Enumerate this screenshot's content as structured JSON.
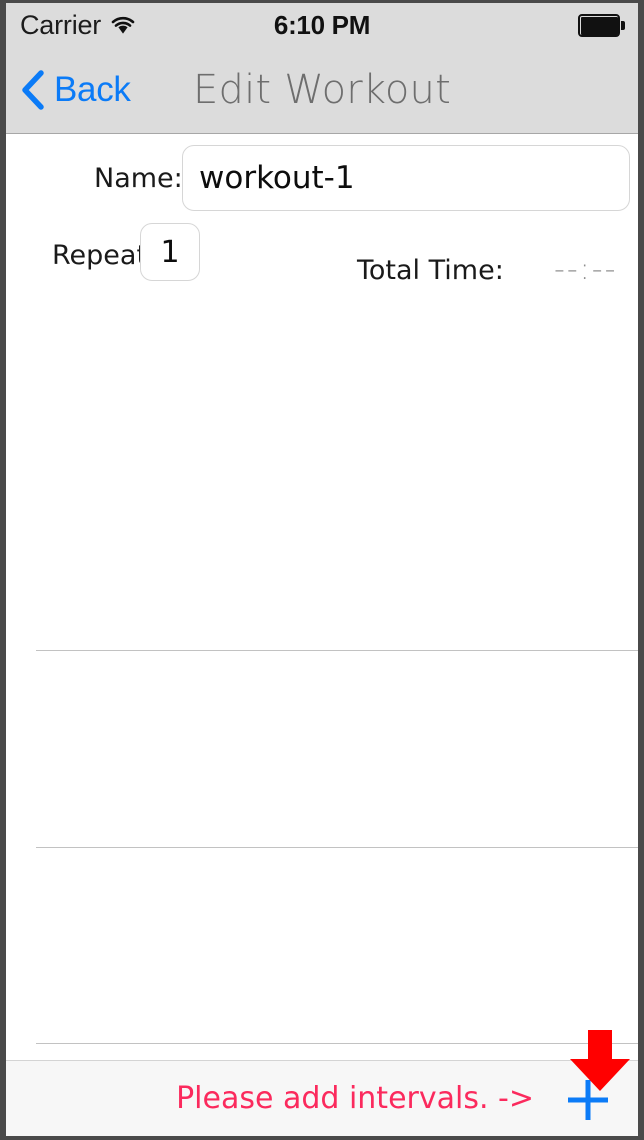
{
  "status_bar": {
    "carrier": "Carrier",
    "wifi_icon": "wifi-icon",
    "time": "6:10 PM",
    "battery_icon": "battery-full-icon"
  },
  "nav_bar": {
    "back_icon": "chevron-left-icon",
    "back_label": "Back",
    "title": "Edit Workout"
  },
  "form": {
    "name_label": "Name:",
    "name_value": "workout-1",
    "name_placeholder": "Name",
    "repeat_label": "Repeat:",
    "repeat_value": "1",
    "repeat_placeholder": "1",
    "total_time_label": "Total Time:",
    "total_time_value": "--:--"
  },
  "intervals_table": {
    "rows": [],
    "separator_count": 3
  },
  "toolbar": {
    "hint_text": "Please add intervals. ->",
    "add_icon": "plus-icon"
  },
  "annotation": {
    "arrow_icon": "down-arrow-icon",
    "arrow_color": "#FF0000"
  },
  "colors": {
    "accent_blue": "#0b7bf7",
    "hint_pink": "#fb2a5d",
    "nav_background": "#dcdcdc",
    "nav_title": "#6e6e6e",
    "toolbar_background": "#f7f7f7",
    "separator": "#c2c2c2",
    "placeholder_gray": "#8e8e8e"
  }
}
